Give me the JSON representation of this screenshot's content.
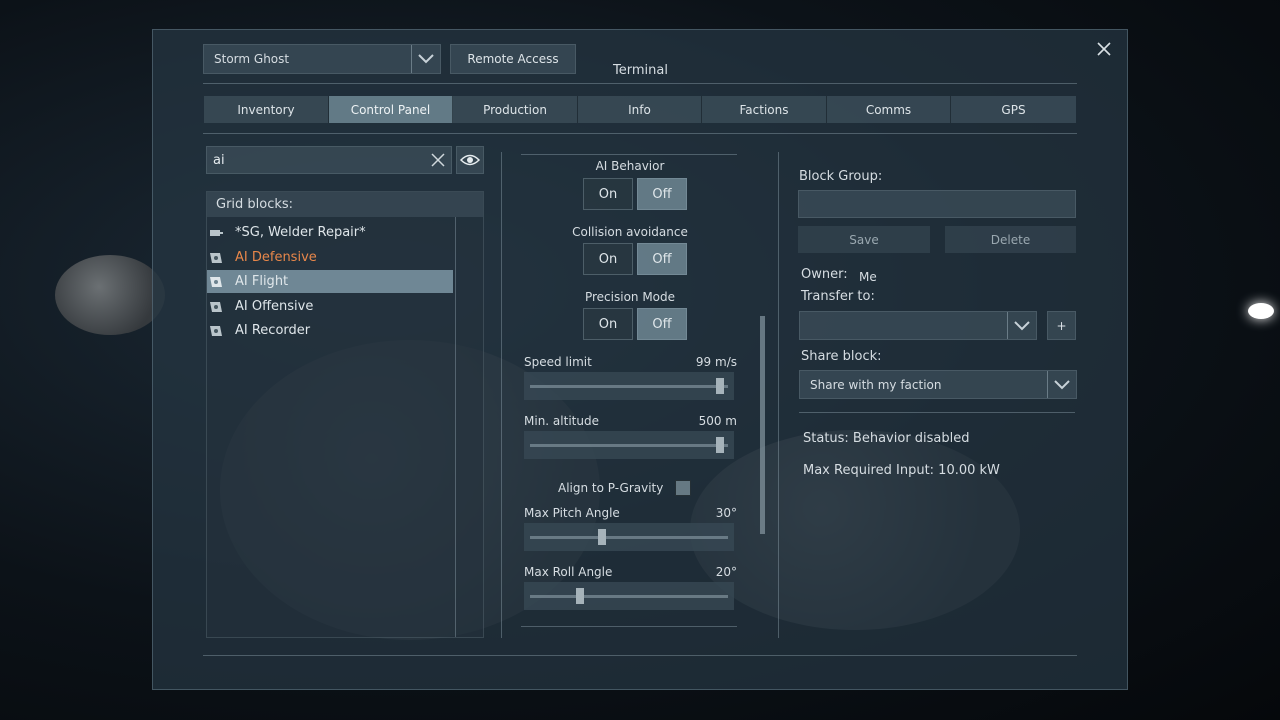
{
  "header": {
    "grid_name": "Storm Ghost",
    "remote_access_label": "Remote Access",
    "title": "Terminal"
  },
  "tabs": [
    {
      "label": "Inventory"
    },
    {
      "label": "Control Panel"
    },
    {
      "label": "Production"
    },
    {
      "label": "Info"
    },
    {
      "label": "Factions"
    },
    {
      "label": "Comms"
    },
    {
      "label": "GPS"
    }
  ],
  "active_tab": "Control Panel",
  "search": {
    "value": "ai"
  },
  "block_list": {
    "header": "Grid blocks:",
    "items": [
      {
        "label": "*SG, Welder Repair*"
      },
      {
        "label": "AI Defensive",
        "color": "#e8874a"
      },
      {
        "label": "AI Flight",
        "selected": true
      },
      {
        "label": "AI Offensive"
      },
      {
        "label": "AI Recorder"
      }
    ]
  },
  "controls": {
    "ai_behavior": {
      "label": "AI Behavior",
      "on": "On",
      "off": "Off",
      "selected": "Off"
    },
    "collision": {
      "label": "Collision avoidance",
      "on": "On",
      "off": "Off",
      "selected": "Off"
    },
    "precision": {
      "label": "Precision Mode",
      "on": "On",
      "off": "Off",
      "selected": "Off"
    },
    "speed_limit": {
      "label": "Speed limit",
      "value": "99 m/s",
      "fraction": 0.98
    },
    "min_altitude": {
      "label": "Min. altitude",
      "value": "500 m",
      "fraction": 0.98
    },
    "align_gravity": {
      "label": "Align to P-Gravity",
      "checked": false
    },
    "max_pitch": {
      "label": "Max Pitch Angle",
      "value": "30°",
      "fraction": 0.36
    },
    "max_roll": {
      "label": "Max Roll Angle",
      "value": "20°",
      "fraction": 0.24
    }
  },
  "right_panel": {
    "block_group_label": "Block Group:",
    "save_label": "Save",
    "delete_label": "Delete",
    "owner_label": "Owner:",
    "owner_value": "Me",
    "transfer_label": "Transfer to:",
    "add_symbol": "+",
    "share_label": "Share block:",
    "share_value": "Share with my faction",
    "status": "Status: Behavior disabled",
    "max_input": "Max Required Input: 10.00 kW"
  },
  "colors": {
    "accent_orange": "#e8874a",
    "selected_row": "#78919e",
    "panel_bg": "#263642"
  }
}
